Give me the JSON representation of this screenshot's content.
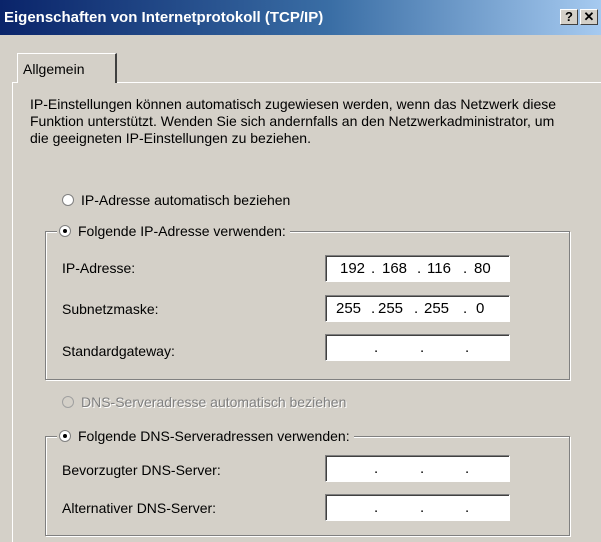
{
  "window": {
    "title": "Eigenschaften von Internetprotokoll (TCP/IP)",
    "help_glyph": "?",
    "close_glyph": "✕"
  },
  "tabs": [
    {
      "label": "Allgemein",
      "active": true
    }
  ],
  "description": "IP-Einstellungen können automatisch zugewiesen werden, wenn das Netzwerk diese Funktion unterstützt. Wenden Sie sich andernfalls an den Netzwerkadministrator, um die geeigneten IP-Einstellungen zu beziehen.",
  "ip_mode": {
    "auto_label": "IP-Adresse automatisch beziehen",
    "manual_label": "Folgende IP-Adresse verwenden:",
    "selected": "manual"
  },
  "ip_fields": [
    {
      "label": "IP-Adresse:",
      "octets": [
        "192",
        "168",
        "116",
        "80"
      ]
    },
    {
      "label": "Subnetzmaske:",
      "octets": [
        "255",
        "255",
        "255",
        "0"
      ]
    },
    {
      "label": "Standardgateway:",
      "octets": [
        "",
        "",
        "",
        ""
      ]
    }
  ],
  "dns_mode": {
    "auto_label": "DNS-Serveradresse automatisch beziehen",
    "auto_disabled": true,
    "manual_label": "Folgende DNS-Serveradressen verwenden:",
    "selected": "manual"
  },
  "dns_fields": [
    {
      "label": "Bevorzugter DNS-Server:",
      "octets": [
        "",
        "",
        "",
        ""
      ]
    },
    {
      "label": "Alternativer DNS-Server:",
      "octets": [
        "",
        "",
        "",
        ""
      ]
    }
  ]
}
